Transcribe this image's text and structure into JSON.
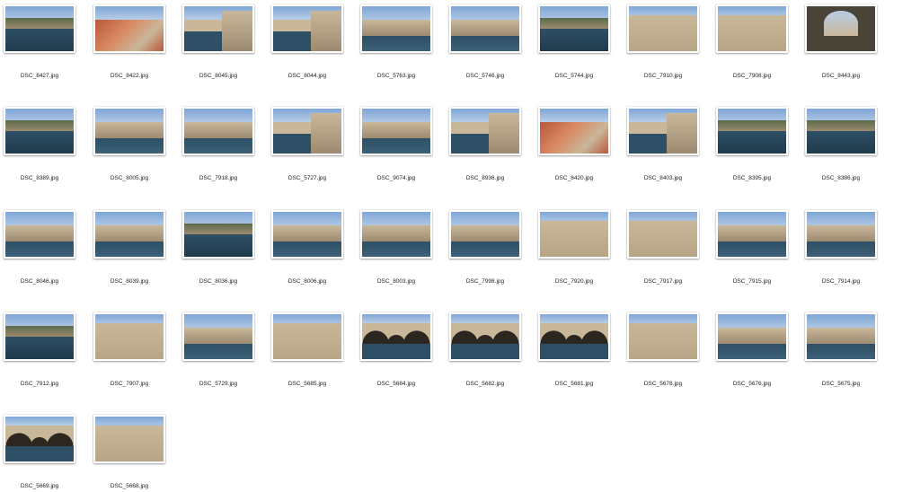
{
  "window": {
    "background": "#ffffff"
  },
  "files": [
    {
      "name": "DSC_8427.jpg",
      "scene": "harbor-aerial"
    },
    {
      "name": "DSC_8422.jpg",
      "scene": "rooftops"
    },
    {
      "name": "DSC_8045.jpg",
      "scene": "harbor-wall"
    },
    {
      "name": "DSC_8044.jpg",
      "scene": "harbor-wall"
    },
    {
      "name": "DSC_5763.jpg",
      "scene": "harbor-town"
    },
    {
      "name": "DSC_5746.jpg",
      "scene": "harbor-town"
    },
    {
      "name": "DSC_5744.jpg",
      "scene": "harbor-aerial"
    },
    {
      "name": "DSC_7910.jpg",
      "scene": "stone-walls"
    },
    {
      "name": "DSC_7908.jpg",
      "scene": "stone-walls"
    },
    {
      "name": "DSC_8443.jpg",
      "scene": "archway"
    },
    {
      "name": "DSC_8389.jpg",
      "scene": "harbor-aerial"
    },
    {
      "name": "DSC_8005.jpg",
      "scene": "harbor-town"
    },
    {
      "name": "DSC_7918.jpg",
      "scene": "harbor-town"
    },
    {
      "name": "DSC_5727.jpg",
      "scene": "harbor-wall"
    },
    {
      "name": "DSC_9074.jpg",
      "scene": "harbor-town"
    },
    {
      "name": "DSC_8936.jpg",
      "scene": "harbor-wall"
    },
    {
      "name": "DSC_8420.jpg",
      "scene": "rooftops"
    },
    {
      "name": "DSC_8403.jpg",
      "scene": "harbor-wall"
    },
    {
      "name": "DSC_8395.jpg",
      "scene": "harbor-aerial"
    },
    {
      "name": "DSC_8386.jpg",
      "scene": "harbor-aerial"
    },
    {
      "name": "DSC_8046.jpg",
      "scene": "harbor-town"
    },
    {
      "name": "DSC_8039.jpg",
      "scene": "harbor-town"
    },
    {
      "name": "DSC_8036.jpg",
      "scene": "harbor-aerial"
    },
    {
      "name": "DSC_8006.jpg",
      "scene": "harbor-town"
    },
    {
      "name": "DSC_8003.jpg",
      "scene": "harbor-town"
    },
    {
      "name": "DSC_7998.jpg",
      "scene": "harbor-town"
    },
    {
      "name": "DSC_7920.jpg",
      "scene": "stone-walls"
    },
    {
      "name": "DSC_7917.jpg",
      "scene": "stone-walls"
    },
    {
      "name": "DSC_7915.jpg",
      "scene": "harbor-town"
    },
    {
      "name": "DSC_7914.jpg",
      "scene": "harbor-town"
    },
    {
      "name": "DSC_7912.jpg",
      "scene": "harbor-aerial"
    },
    {
      "name": "DSC_7907.jpg",
      "scene": "stone-walls"
    },
    {
      "name": "DSC_5729.jpg",
      "scene": "harbor-town"
    },
    {
      "name": "DSC_5685.jpg",
      "scene": "stone-walls"
    },
    {
      "name": "DSC_5684.jpg",
      "scene": "arcade"
    },
    {
      "name": "DSC_5682.jpg",
      "scene": "arcade"
    },
    {
      "name": "DSC_5681.jpg",
      "scene": "arcade"
    },
    {
      "name": "DSC_5678.jpg",
      "scene": "stone-walls"
    },
    {
      "name": "DSC_5676.jpg",
      "scene": "harbor-town"
    },
    {
      "name": "DSC_5675.jpg",
      "scene": "harbor-town"
    },
    {
      "name": "DSC_5669.jpg",
      "scene": "arcade"
    },
    {
      "name": "DSC_5668.jpg",
      "scene": "stone-walls"
    }
  ],
  "palette": {
    "sky": "#7fa6d6",
    "sky_light": "#b8cde6",
    "stone": "#c9b79a",
    "stone_dark": "#9c8b70",
    "roof": "#b9573a",
    "sea": "#2e4f66",
    "hill": "#5b6a4a",
    "label_color": "#222222"
  }
}
